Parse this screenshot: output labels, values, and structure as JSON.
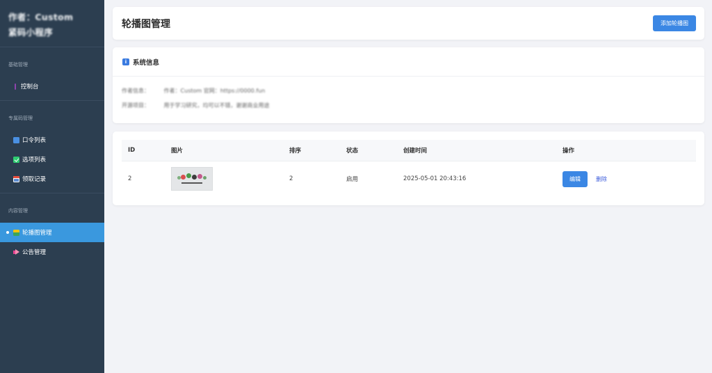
{
  "sidebar": {
    "brand": [
      "作者：Custom",
      "紧码小程序"
    ],
    "sections": [
      {
        "title": "基础管理",
        "items": [
          {
            "label": "控制台",
            "icon": "dashboard-icon"
          }
        ]
      },
      {
        "title": "专属码管理",
        "items": [
          {
            "label": "口令列表",
            "icon": "numbers-icon"
          },
          {
            "label": "选项列表",
            "icon": "checkbox-icon"
          },
          {
            "label": "领取记录",
            "icon": "calendar-icon"
          }
        ]
      },
      {
        "title": "内容管理",
        "items": [
          {
            "label": "轮播图管理",
            "icon": "picture-icon",
            "active": true
          },
          {
            "label": "公告管理",
            "icon": "megaphone-icon"
          }
        ]
      }
    ]
  },
  "header": {
    "title": "轮播图管理",
    "add_button": "添加轮播图"
  },
  "system_info": {
    "title": "系统信息",
    "rows": [
      {
        "label": "作者信息：",
        "value": "作者：Custom 官网：https://0000.fun"
      },
      {
        "label": "开源项目：",
        "value": "用于学习研究，均可以不错，谢谢商业用途"
      }
    ]
  },
  "table": {
    "columns": [
      "ID",
      "图片",
      "排序",
      "状态",
      "创建时间",
      "操作"
    ],
    "rows": [
      {
        "id": "2",
        "sort": "2",
        "status": "启用",
        "created": "2025-05-01 20:43:16",
        "edit": "编辑",
        "delete": "删除"
      }
    ]
  },
  "colors": {
    "sidebar": "#2c3e50",
    "active": "#3a98de",
    "primary": "#3b87e4",
    "link": "#3b5bdb"
  }
}
